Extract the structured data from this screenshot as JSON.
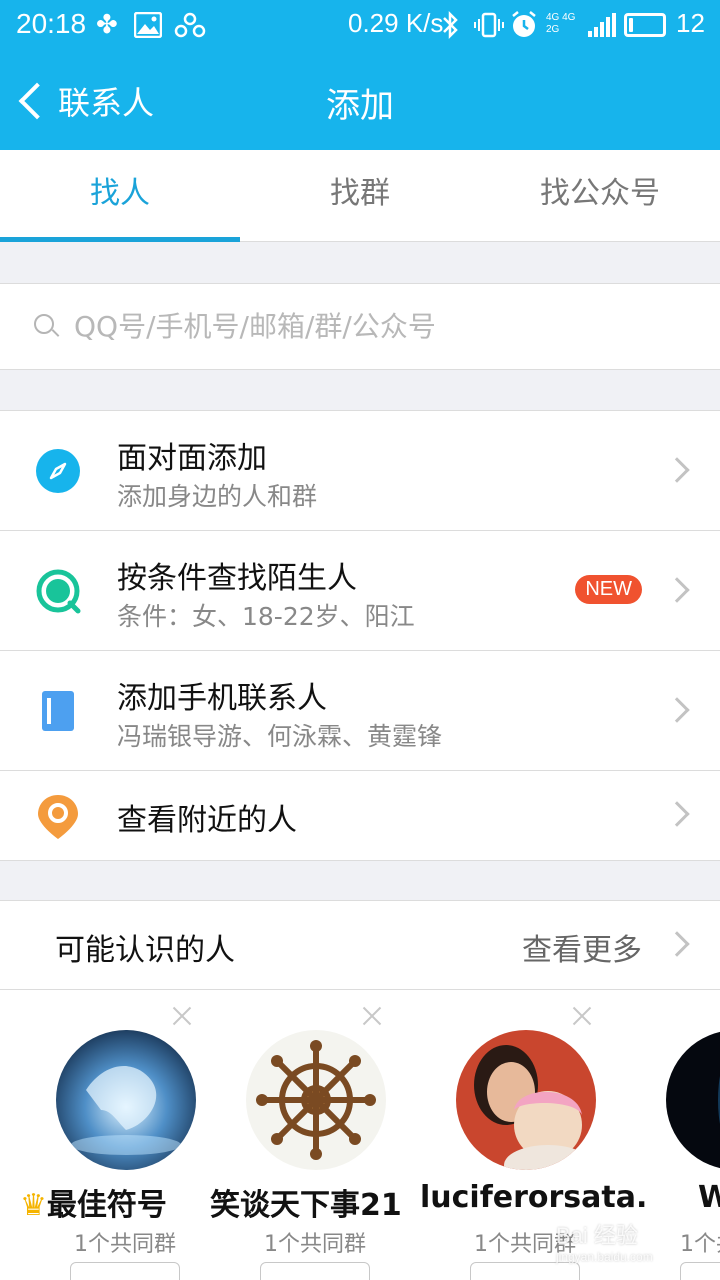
{
  "status_bar": {
    "time": "20:18",
    "speed": "0.29 K/s",
    "network_top": "4G 4G",
    "network_bottom": "2G",
    "battery_level": 12,
    "battery_text": "12",
    "icons": [
      "clover-icon",
      "image-icon",
      "link-icon",
      "bluetooth-icon",
      "vibrate-icon",
      "alarm-icon",
      "signal-icon",
      "battery-icon"
    ]
  },
  "header": {
    "back_label": "联系人",
    "title": "添加"
  },
  "tabs": [
    {
      "label": "找人",
      "active": true
    },
    {
      "label": "找群",
      "active": false
    },
    {
      "label": "找公众号",
      "active": false
    }
  ],
  "search": {
    "placeholder": "QQ号/手机号/邮箱/群/公众号",
    "value": ""
  },
  "menu": [
    {
      "title": "面对面添加",
      "subtitle": "添加身边的人和群",
      "icon": "compass-icon"
    },
    {
      "title": "按条件查找陌生人",
      "subtitle": "条件：女、18-22岁、阳江",
      "icon": "search-stranger-icon",
      "badge": "NEW"
    },
    {
      "title": "添加手机联系人",
      "subtitle": "冯瑞银导游、何泳霖、黄霆锋",
      "icon": "contacts-book-icon"
    },
    {
      "title": "查看附近的人",
      "icon": "location-pin-icon"
    }
  ],
  "people_section": {
    "label": "可能认识的人",
    "more_label": "查看更多"
  },
  "people": [
    {
      "name": "最佳符号",
      "mutual": "1个共同群",
      "avatar": "unicorn-avatar"
    },
    {
      "name": "笑谈天下事21",
      "mutual": "1个共同群",
      "avatar": "ship-wheel-avatar"
    },
    {
      "name": "luciferorsata.",
      "mutual": "1个共同群",
      "avatar": "mother-baby-avatar"
    },
    {
      "name": "W",
      "mutual": "1个共",
      "avatar": "dark-figure-avatar"
    }
  ],
  "watermark": {
    "text": "Bai 经验",
    "sub": "jingyan.baidu.com"
  },
  "colors": {
    "primary": "#17b4ec",
    "tab_active": "#1aa3d9",
    "badge": "#f0522f",
    "pin": "#f49b3d",
    "contacts": "#4da0f0",
    "stranger": "#19c49a"
  }
}
